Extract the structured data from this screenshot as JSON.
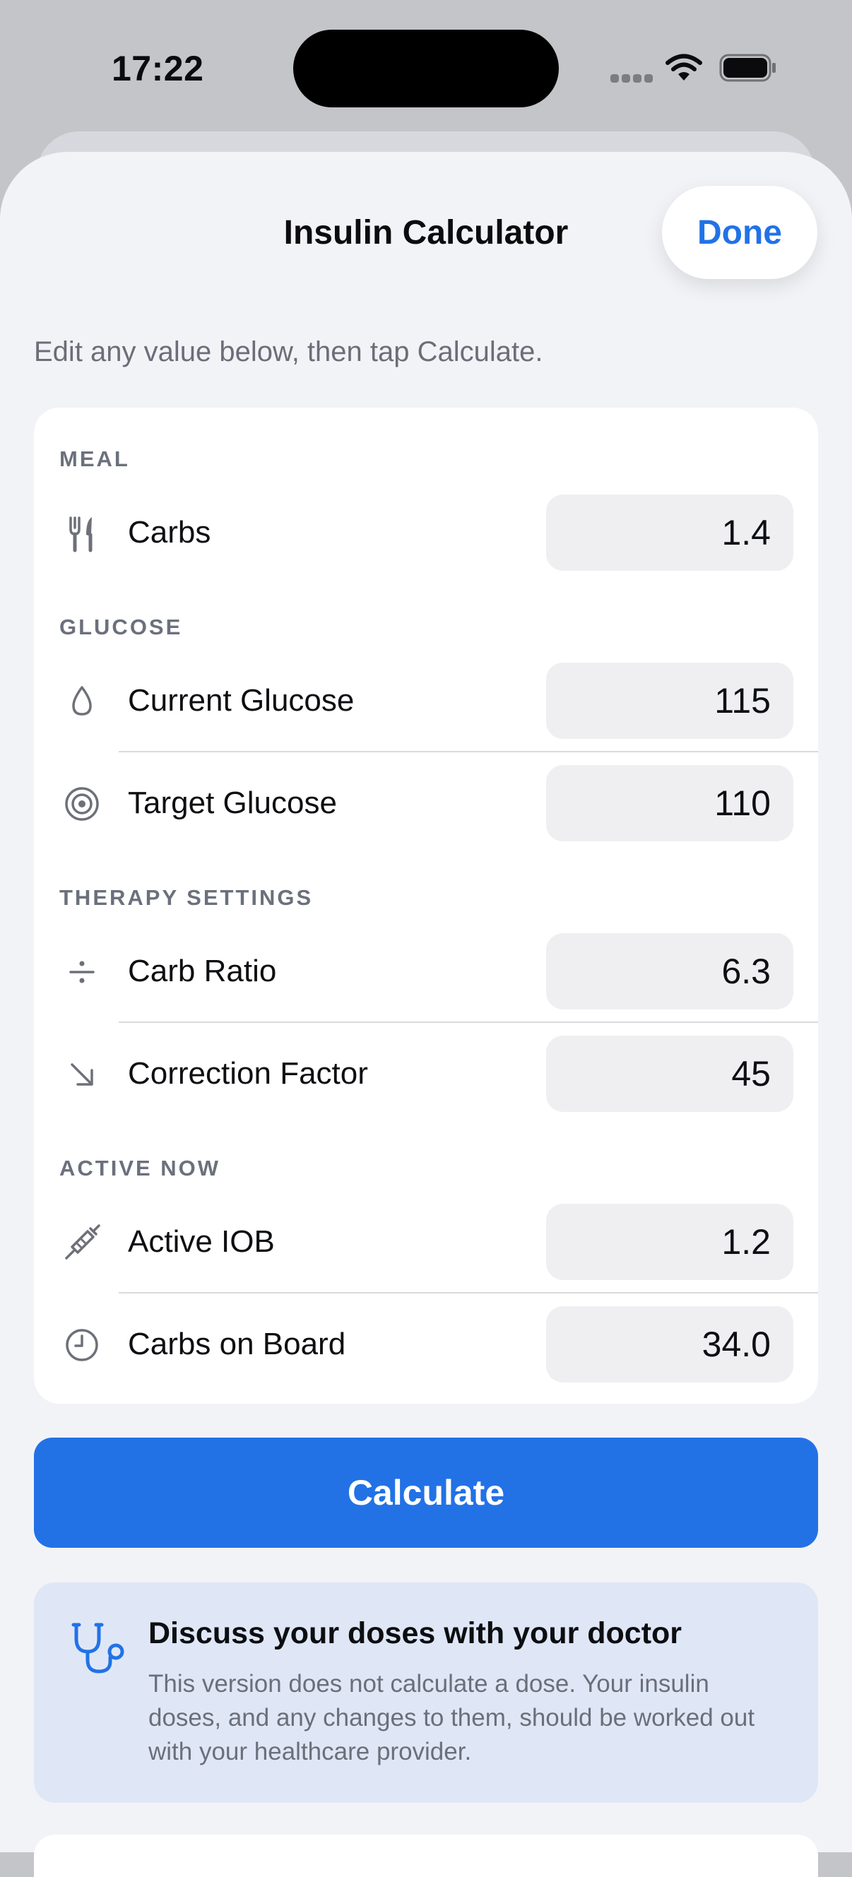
{
  "status_bar": {
    "time": "17:22"
  },
  "header": {
    "title": "Insulin Calculator",
    "done_label": "Done"
  },
  "subtitle": "Edit any value below, then tap Calculate.",
  "sections": {
    "meal": "MEAL",
    "glucose": "GLUCOSE",
    "therapy": "THERAPY SETTINGS",
    "active": "ACTIVE NOW"
  },
  "fields": {
    "carbs": {
      "label": "Carbs",
      "value": "1.4",
      "icon": "fork-knife-icon"
    },
    "current_glucose": {
      "label": "Current Glucose",
      "value": "115",
      "icon": "drop-icon"
    },
    "target_glucose": {
      "label": "Target Glucose",
      "value": "110",
      "icon": "target-icon"
    },
    "carb_ratio": {
      "label": "Carb Ratio",
      "value": "6.3",
      "icon": "divide-icon"
    },
    "correction_factor": {
      "label": "Correction Factor",
      "value": "45",
      "icon": "arrow-down-right-icon"
    },
    "active_iob": {
      "label": "Active IOB",
      "value": "1.2",
      "icon": "syringe-icon"
    },
    "carbs_on_board": {
      "label": "Carbs on Board",
      "value": "34.0",
      "icon": "clock-icon"
    }
  },
  "calculate_label": "Calculate",
  "notice": {
    "title": "Discuss your doses with your doctor",
    "body": "This version does not calculate a dose. Your insulin doses, and any changes to them, should be worked out with your healthcare provider.",
    "icon": "stethoscope-icon"
  },
  "colors": {
    "accent": "#2272e6",
    "sheet_background": "#f2f3f7",
    "card_background": "#ffffff",
    "field_background": "#efeff1",
    "notice_background": "#dfe7f7",
    "secondary_text": "#6b6e78"
  }
}
